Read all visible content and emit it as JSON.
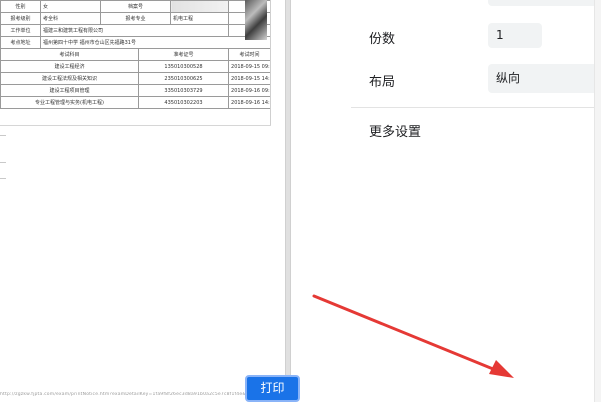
{
  "document": {
    "rows": {
      "gender_label": "性别",
      "gender_value": "女",
      "file_no_label": "档案号",
      "level_label": "报考级别",
      "level_value": "考全科",
      "major_label": "报考专业",
      "major_value": "机电工程",
      "employer_label": "工作单位",
      "employer_value": "福建三和建筑工程有限公司",
      "site_label": "考点地址",
      "site_value": "福州第四十中学 福州市仓山区先福路31号"
    },
    "exam_table": {
      "headers": [
        "考试科目",
        "准考证号",
        "考试时间"
      ],
      "rows": [
        [
          "建设工程经济",
          "135010300528",
          "2018-09-15 09:00--11:00"
        ],
        [
          "建设工程法规及相关知识",
          "235010300625",
          "2018-09-15 14:00--17:00"
        ],
        [
          "建设工程项目管理",
          "335010303729",
          "2018-09-16 09:00--12:00"
        ],
        [
          "专业工程管理与实务(机电工程)",
          "435010302203",
          "2018-09-16 14:00--18:00"
        ]
      ]
    },
    "footer_url": "http://zgzkw.fjpta.com/exam/printNotice.htm?examDetailKey=1fa9f8f26ec3d8a91b0a2c5e7c8f1f4e&z=0.2186739518262&m=20180910&u=9c8d6b5a4f3e2d1c0b9a8f7e6d5c4b3a2918"
  },
  "settings": {
    "copies_label": "份数",
    "copies_value": "1",
    "layout_label": "布局",
    "layout_value": "纵向",
    "more_settings_label": "更多设置",
    "print_button": "打印"
  },
  "colors": {
    "accent": "#1a73e8",
    "annotation_arrow": "#e53935"
  }
}
